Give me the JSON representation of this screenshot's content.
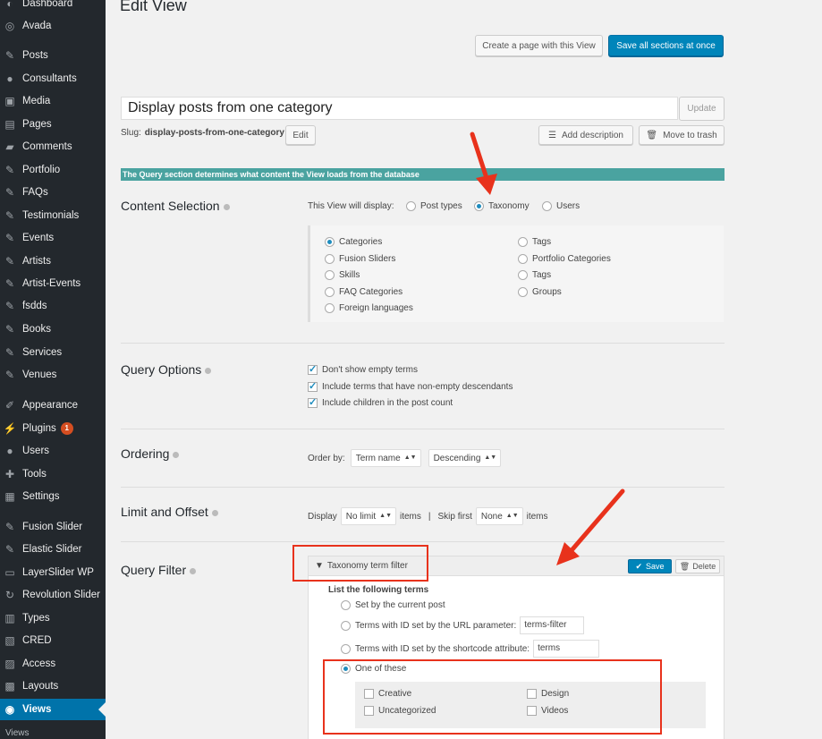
{
  "sidebar": {
    "items": [
      {
        "label": "Dashboard",
        "icon": "dashboard-icon",
        "glyph": "◐"
      },
      {
        "label": "Avada",
        "icon": "avada-icon",
        "glyph": "◎"
      },
      {
        "label": "Posts",
        "icon": "pin-icon",
        "glyph": "✎"
      },
      {
        "label": "Consultants",
        "icon": "users-icon",
        "glyph": "●"
      },
      {
        "label": "Media",
        "icon": "media-icon",
        "glyph": "▣"
      },
      {
        "label": "Pages",
        "icon": "pages-icon",
        "glyph": "▤"
      },
      {
        "label": "Comments",
        "icon": "comments-icon",
        "glyph": "▰"
      },
      {
        "label": "Portfolio",
        "icon": "pin-icon",
        "glyph": "✎"
      },
      {
        "label": "FAQs",
        "icon": "pin-icon",
        "glyph": "✎"
      },
      {
        "label": "Testimonials",
        "icon": "pin-icon",
        "glyph": "✎"
      },
      {
        "label": "Events",
        "icon": "pin-icon",
        "glyph": "✎"
      },
      {
        "label": "Artists",
        "icon": "pin-icon",
        "glyph": "✎"
      },
      {
        "label": "Artist-Events",
        "icon": "pin-icon",
        "glyph": "✎"
      },
      {
        "label": "fsdds",
        "icon": "pin-icon",
        "glyph": "✎"
      },
      {
        "label": "Books",
        "icon": "pin-icon",
        "glyph": "✎"
      },
      {
        "label": "Services",
        "icon": "pin-icon",
        "glyph": "✎"
      },
      {
        "label": "Venues",
        "icon": "pin-icon",
        "glyph": "✎"
      },
      {
        "label": "Appearance",
        "icon": "brush-icon",
        "glyph": "✐"
      },
      {
        "label": "Plugins",
        "icon": "plug-icon",
        "glyph": "⚡",
        "badge": "1"
      },
      {
        "label": "Users",
        "icon": "user-icon",
        "glyph": "●"
      },
      {
        "label": "Tools",
        "icon": "wrench-icon",
        "glyph": "✚"
      },
      {
        "label": "Settings",
        "icon": "settings-icon",
        "glyph": "▦"
      },
      {
        "label": "Fusion Slider",
        "icon": "pin-icon",
        "glyph": "✎"
      },
      {
        "label": "Elastic Slider",
        "icon": "pin-icon",
        "glyph": "✎"
      },
      {
        "label": "LayerSlider WP",
        "icon": "layers-icon",
        "glyph": "▭"
      },
      {
        "label": "Revolution Slider",
        "icon": "refresh-icon",
        "glyph": "↻"
      },
      {
        "label": "Types",
        "icon": "types-icon",
        "glyph": "▥"
      },
      {
        "label": "CRED",
        "icon": "cred-icon",
        "glyph": "▧"
      },
      {
        "label": "Access",
        "icon": "access-icon",
        "glyph": "▨"
      },
      {
        "label": "Layouts",
        "icon": "layouts-icon",
        "glyph": "▩"
      },
      {
        "label": "Views",
        "icon": "views-icon",
        "glyph": "◉",
        "current": true
      }
    ],
    "submenu_label": "Views"
  },
  "header": {
    "title": "Edit View",
    "create_page_label": "Create a page with this View",
    "save_all_label": "Save all sections at once"
  },
  "view": {
    "title_value": "Display posts from one category",
    "update_label": "Update",
    "slug_label": "Slug:",
    "slug_value": "display-posts-from-one-category",
    "edit_label": "Edit",
    "add_description_label": "Add description",
    "move_trash_label": "Move to trash"
  },
  "query_bar_text": "The Query section determines what content the View loads from the database",
  "content_selection": {
    "title": "Content Selection",
    "display_label": "This View will display:",
    "modes": [
      {
        "label": "Post types",
        "checked": false
      },
      {
        "label": "Taxonomy",
        "checked": true
      },
      {
        "label": "Users",
        "checked": false
      }
    ],
    "taxonomies_left": [
      {
        "label": "Categories",
        "checked": true
      },
      {
        "label": "Fusion Sliders",
        "checked": false
      },
      {
        "label": "Skills",
        "checked": false
      },
      {
        "label": "FAQ Categories",
        "checked": false
      },
      {
        "label": "Foreign languages",
        "checked": false
      }
    ],
    "taxonomies_right": [
      {
        "label": "Tags",
        "checked": false
      },
      {
        "label": "Portfolio Categories",
        "checked": false
      },
      {
        "label": "Tags",
        "checked": false
      },
      {
        "label": "Groups",
        "checked": false
      }
    ]
  },
  "query_options": {
    "title": "Query Options",
    "options": [
      {
        "label": "Don't show empty terms",
        "checked": true
      },
      {
        "label": "Include terms that have non-empty descendants",
        "checked": true
      },
      {
        "label": "Include children in the post count",
        "checked": true
      }
    ]
  },
  "ordering": {
    "title": "Ordering",
    "order_by_label": "Order by:",
    "field_value": "Term name",
    "direction_value": "Descending"
  },
  "limit": {
    "title": "Limit and Offset",
    "display_label": "Display",
    "limit_value": "No limit",
    "items_label": "items",
    "separator": "|",
    "skip_label": "Skip first",
    "skip_value": "None",
    "items_label2": "items"
  },
  "query_filter": {
    "title": "Query Filter",
    "filter_title": "Taxonomy term filter",
    "save_label": "Save",
    "delete_label": "Delete",
    "list_label": "List the following terms",
    "options": [
      {
        "label": "Set by the current post",
        "checked": false
      },
      {
        "label": "Terms with ID set by the URL parameter:",
        "checked": false,
        "field": "terms-filter"
      },
      {
        "label": "Terms with ID set by the shortcode attribute:",
        "checked": false,
        "field": "terms"
      },
      {
        "label": "One of these",
        "checked": true
      }
    ],
    "terms": [
      {
        "label": "Creative",
        "checked": false
      },
      {
        "label": "Design",
        "checked": false
      },
      {
        "label": "Uncategorized",
        "checked": false
      },
      {
        "label": "Videos",
        "checked": false
      }
    ]
  },
  "colors": {
    "sidebar_bg": "#23282d",
    "primary": "#0085ba",
    "query_bar": "#4aa3a0",
    "annotation": "#e8321c"
  }
}
